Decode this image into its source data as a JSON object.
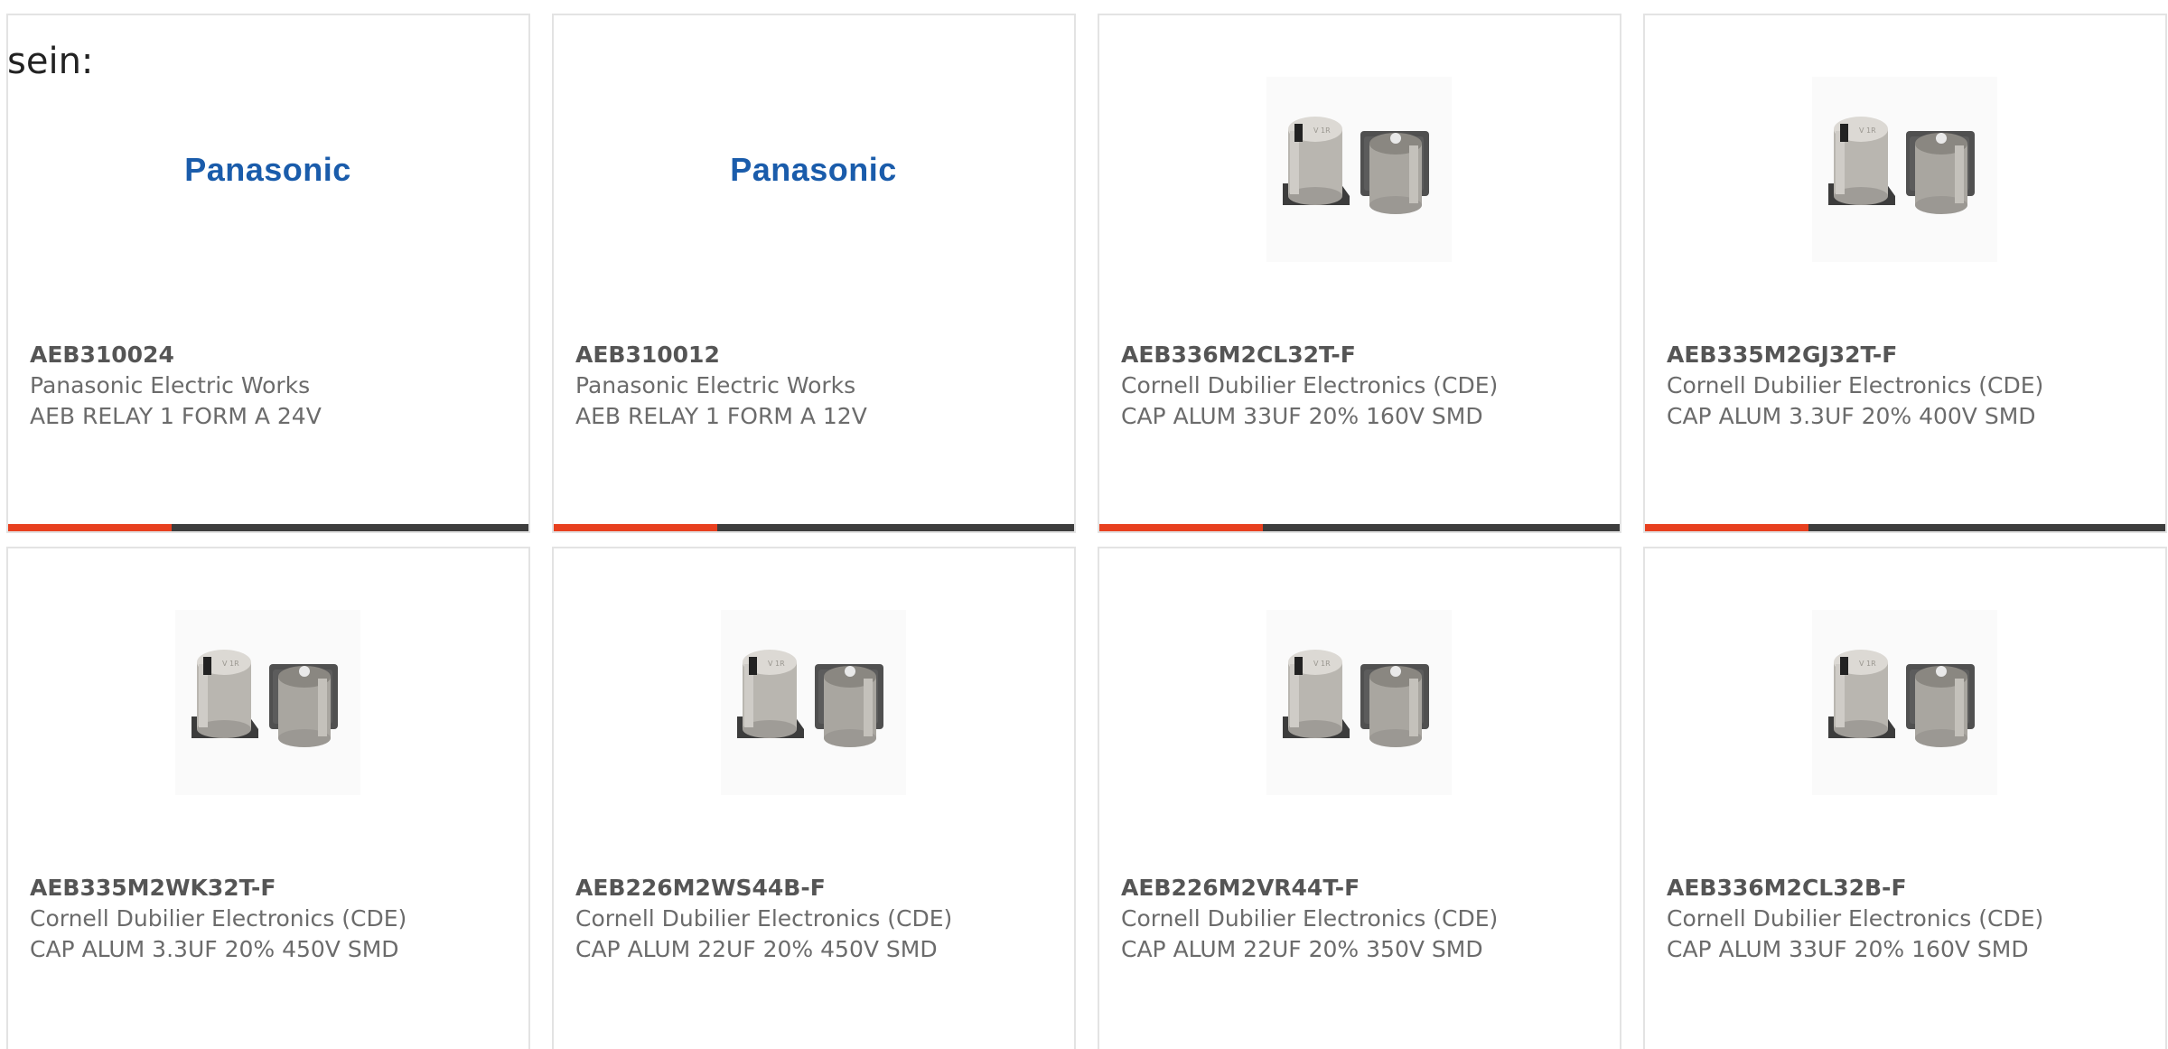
{
  "intro_text": "sein:",
  "accent_color": "#e8401f",
  "bar_color": "#3d3d3d",
  "products": [
    {
      "part_number": "AEB310024",
      "manufacturer": "Panasonic Electric Works",
      "description": "AEB RELAY 1 FORM A 24V",
      "image": "panasonic-logo",
      "logo_text": "Panasonic",
      "progress": 0.315
    },
    {
      "part_number": "AEB310012",
      "manufacturer": "Panasonic Electric Works",
      "description": "AEB RELAY 1 FORM A 12V",
      "image": "panasonic-logo",
      "logo_text": "Panasonic",
      "progress": 0.315
    },
    {
      "part_number": "AEB336M2CL32T-F",
      "manufacturer": "Cornell Dubilier Electronics (CDE)",
      "description": "CAP ALUM 33UF 20% 160V SMD",
      "image": "capacitor-photo",
      "progress": 0.315
    },
    {
      "part_number": "AEB335M2GJ32T-F",
      "manufacturer": "Cornell Dubilier Electronics (CDE)",
      "description": "CAP ALUM 3.3UF 20% 400V SMD",
      "image": "capacitor-photo",
      "progress": 0.315
    },
    {
      "part_number": "AEB335M2WK32T-F",
      "manufacturer": "Cornell Dubilier Electronics (CDE)",
      "description": "CAP ALUM 3.3UF 20% 450V SMD",
      "image": "capacitor-photo"
    },
    {
      "part_number": "AEB226M2WS44B-F",
      "manufacturer": "Cornell Dubilier Electronics (CDE)",
      "description": "CAP ALUM 22UF 20% 450V SMD",
      "image": "capacitor-photo"
    },
    {
      "part_number": "AEB226M2VR44T-F",
      "manufacturer": "Cornell Dubilier Electronics (CDE)",
      "description": "CAP ALUM 22UF 20% 350V SMD",
      "image": "capacitor-photo"
    },
    {
      "part_number": "AEB336M2CL32B-F",
      "manufacturer": "Cornell Dubilier Electronics (CDE)",
      "description": "CAP ALUM 33UF 20% 160V SMD",
      "image": "capacitor-photo"
    }
  ]
}
